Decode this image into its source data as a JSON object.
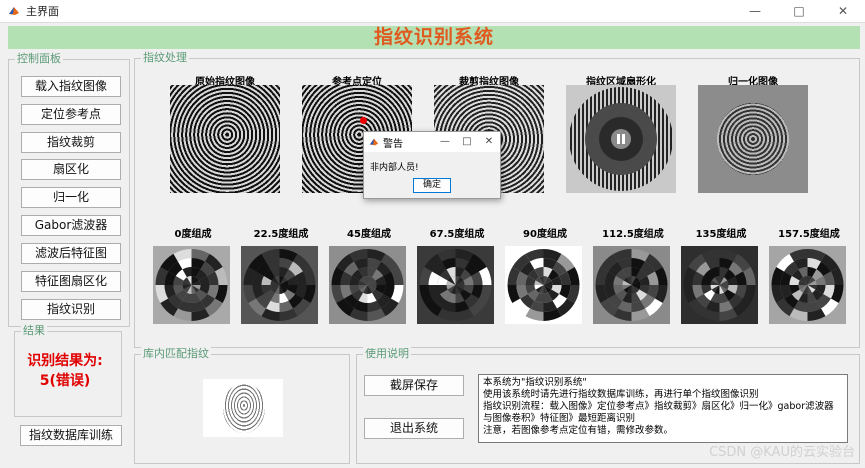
{
  "window": {
    "title": "主界面",
    "minimize_icon": "minimize-icon",
    "maximize_icon": "maximize-icon",
    "close_icon": "close-icon"
  },
  "banner": {
    "title": "指纹识别系统"
  },
  "control_panel": {
    "title": "控制面板",
    "buttons": [
      "载入指纹图像",
      "定位参考点",
      "指纹裁剪",
      "扇区化",
      "归一化",
      "Gabor滤波器",
      "滤波后特征图",
      "特征图扇区化",
      "指纹识别"
    ]
  },
  "result_panel": {
    "title": "结果",
    "line1": "识别结果为:",
    "line2": "5(错误)"
  },
  "train_button": "指纹数据库训练",
  "processing_panel": {
    "title": "指纹处理",
    "top_labels": [
      "原始指纹图像",
      "参考点定位",
      "裁剪指纹图像",
      "指纹区域扇形化",
      "归一化图像"
    ],
    "bottom_labels": [
      "0度组成",
      "22.5度组成",
      "45度组成",
      "67.5度组成",
      "90度组成",
      "112.5度组成",
      "135度组成",
      "157.5度组成"
    ]
  },
  "library_panel": {
    "title": "库内匹配指纹"
  },
  "usage_panel": {
    "title": "使用说明",
    "save_button": "截屏保存",
    "exit_button": "退出系统",
    "text_lines": [
      "本系统为\"指纹识别系统\"",
      "使用该系统时请先进行指纹数据库训练，再进行单个指纹图像识别",
      "指纹识别流程：载入图像》定位参考点》指纹裁剪》扇区化》归一化》gabor滤波器",
      "与图像卷积》特征图》最短距离识别",
      "注意，若图像参考点定位有错，需修改参数。"
    ]
  },
  "dialog": {
    "title": "警告",
    "message": "非内部人员!",
    "ok_button": "确定"
  },
  "watermark": "CSDN @KAU的云实验台",
  "colors": {
    "banner_bg": "#b4e1b4",
    "banner_text": "#e05a1f",
    "panel_title": "#5a9a76",
    "result_text": "#e00000"
  }
}
